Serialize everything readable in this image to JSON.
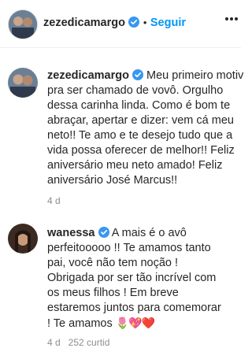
{
  "header": {
    "username": "zezedicamargo",
    "separator": "•",
    "follow_label": "Seguir"
  },
  "caption": {
    "author": "zezedicamargo",
    "lines": [
      "Meu primeiro motiv",
      "pra ser chamado de vovô. Orgulho",
      "dessa carinha linda. Como é bom te",
      "abraçar, apertar e dizer: vem cá meu",
      "neto!! Te amo e te desejo tudo que a",
      "vida possa oferecer de melhor!! Feliz",
      "aniversário meu neto amado! Feliz",
      "aniversário José Marcus!!"
    ],
    "time": "4 d"
  },
  "comment": {
    "author": "wanessa",
    "lines": [
      "A mais é o avô",
      "perfeitooooo !! Te amamos tanto",
      "pai, você não tem noção !",
      "Obrigada por ser tão incrível com",
      "os meus filhos ! Em breve",
      "estaremos juntos para comemorar",
      "! Te amamos"
    ],
    "emojis": "🌷💖❤️",
    "meta_partial": "4 d   252 curtid"
  },
  "colors": {
    "verified": "#3897f0",
    "follow": "#0095f6",
    "meta": "#8e8e8e"
  }
}
